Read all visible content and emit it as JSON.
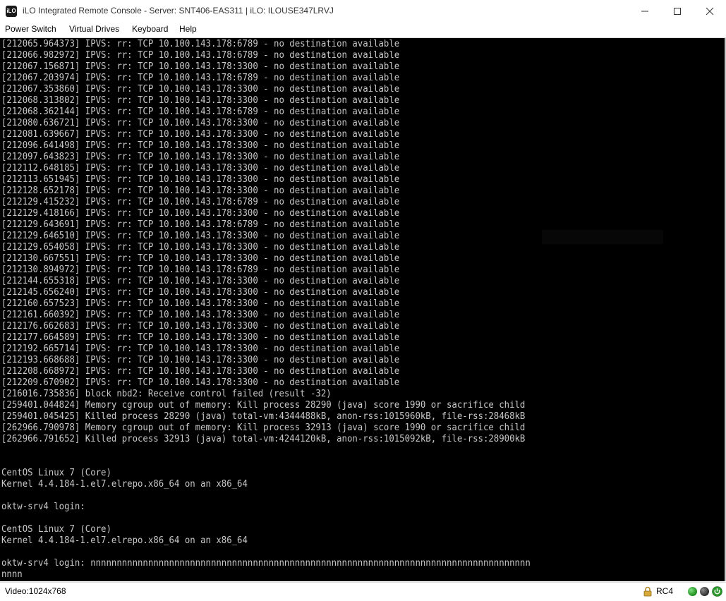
{
  "window": {
    "icon_label": "iLO",
    "title": "iLO Integrated Remote Console - Server: SNT406-EAS311 | iLO: ILOUSE347LRVJ"
  },
  "menu": {
    "items": [
      "Power Switch",
      "Virtual Drives",
      "Keyboard",
      "Help"
    ]
  },
  "console": {
    "lines": [
      "[212065.964373] IPVS: rr: TCP 10.100.143.178:6789 - no destination available",
      "[212066.982972] IPVS: rr: TCP 10.100.143.178:6789 - no destination available",
      "[212067.156871] IPVS: rr: TCP 10.100.143.178:3300 - no destination available",
      "[212067.203974] IPVS: rr: TCP 10.100.143.178:6789 - no destination available",
      "[212067.353860] IPVS: rr: TCP 10.100.143.178:3300 - no destination available",
      "[212068.313802] IPVS: rr: TCP 10.100.143.178:3300 - no destination available",
      "[212068.362144] IPVS: rr: TCP 10.100.143.178:6789 - no destination available",
      "[212080.636721] IPVS: rr: TCP 10.100.143.178:3300 - no destination available",
      "[212081.639667] IPVS: rr: TCP 10.100.143.178:3300 - no destination available",
      "[212096.641498] IPVS: rr: TCP 10.100.143.178:3300 - no destination available",
      "[212097.643823] IPVS: rr: TCP 10.100.143.178:3300 - no destination available",
      "[212112.648185] IPVS: rr: TCP 10.100.143.178:3300 - no destination available",
      "[212113.651945] IPVS: rr: TCP 10.100.143.178:3300 - no destination available",
      "[212128.652178] IPVS: rr: TCP 10.100.143.178:3300 - no destination available",
      "[212129.415232] IPVS: rr: TCP 10.100.143.178:6789 - no destination available",
      "[212129.418166] IPVS: rr: TCP 10.100.143.178:3300 - no destination available",
      "[212129.643691] IPVS: rr: TCP 10.100.143.178:6789 - no destination available",
      "[212129.646510] IPVS: rr: TCP 10.100.143.178:3300 - no destination available",
      "[212129.654058] IPVS: rr: TCP 10.100.143.178:3300 - no destination available",
      "[212130.667551] IPVS: rr: TCP 10.100.143.178:3300 - no destination available",
      "[212130.894972] IPVS: rr: TCP 10.100.143.178:6789 - no destination available",
      "[212144.655318] IPVS: rr: TCP 10.100.143.178:3300 - no destination available",
      "[212145.656240] IPVS: rr: TCP 10.100.143.178:3300 - no destination available",
      "[212160.657523] IPVS: rr: TCP 10.100.143.178:3300 - no destination available",
      "[212161.660392] IPVS: rr: TCP 10.100.143.178:3300 - no destination available",
      "[212176.662683] IPVS: rr: TCP 10.100.143.178:3300 - no destination available",
      "[212177.664589] IPVS: rr: TCP 10.100.143.178:3300 - no destination available",
      "[212192.665714] IPVS: rr: TCP 10.100.143.178:3300 - no destination available",
      "[212193.668688] IPVS: rr: TCP 10.100.143.178:3300 - no destination available",
      "[212208.668972] IPVS: rr: TCP 10.100.143.178:3300 - no destination available",
      "[212209.670902] IPVS: rr: TCP 10.100.143.178:3300 - no destination available",
      "[216016.735836] block nbd2: Receive control failed (result -32)",
      "[259401.044824] Memory cgroup out of memory: Kill process 28290 (java) score 1990 or sacrifice child",
      "[259401.045425] Killed process 28290 (java) total-vm:4344488kB, anon-rss:1015960kB, file-rss:28468kB",
      "[262966.790978] Memory cgroup out of memory: Kill process 32913 (java) score 1990 or sacrifice child",
      "[262966.791652] Killed process 32913 (java) total-vm:4244120kB, anon-rss:1015092kB, file-rss:28900kB",
      "",
      "",
      "CentOS Linux 7 (Core)",
      "Kernel 4.4.184-1.el7.elrepo.x86_64 on an x86_64",
      "",
      "oktw-srv4 login:",
      "",
      "CentOS Linux 7 (Core)",
      "Kernel 4.4.184-1.el7.elrepo.x86_64 on an x86_64",
      "",
      "oktw-srv4 login: nnnnnnnnnnnnnnnnnnnnnnnnnnnnnnnnnnnnnnnnnnnnnnnnnnnnnnnnnnnnnnnnnnnnnnnnnnnnnnnnnnnn",
      "nnnn"
    ]
  },
  "status": {
    "video": "Video:1024x768",
    "encryption": "RC4"
  },
  "colors": {
    "console_bg": "#000000",
    "console_fg": "#c8c8c8",
    "led_active": "#2aa52a",
    "led_idle": "#3a3a3a"
  }
}
